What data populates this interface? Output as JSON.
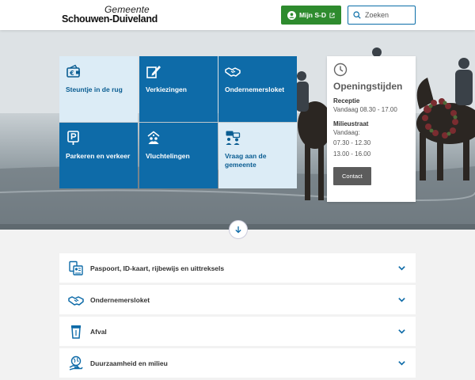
{
  "header": {
    "logo_line1": "Gemeente",
    "logo_line2": "Schouwen-Duiveland",
    "mijn_label": "Mijn S-D",
    "search_placeholder": "Zoeken"
  },
  "tiles": [
    {
      "label": "Steuntje in de rug",
      "icon": "euro-wallet-icon"
    },
    {
      "label": "Verkiezingen",
      "icon": "ballot-pen-icon"
    },
    {
      "label": "Ondernemersloket",
      "icon": "handshake-icon"
    },
    {
      "label": "Parkeren en verkeer",
      "icon": "parking-sign-icon"
    },
    {
      "label": "Vluchtelingen",
      "icon": "refugee-house-icon"
    },
    {
      "label": "Vraag aan de gemeente",
      "icon": "chat-people-icon"
    }
  ],
  "hours": {
    "title": "Openingstijden",
    "reception_title": "Receptie",
    "reception_today": "Vandaag 08.30 - 17.00",
    "milieu_title": "Milieustraat",
    "milieu_today_label": "Vandaag:",
    "milieu_slot1": "07.30 - 12.30",
    "milieu_slot2": "13.00 - 16.00",
    "contact_label": "Contact"
  },
  "accordion": [
    {
      "label": "Paspoort, ID-kaart, rijbewijs en uittreksels",
      "icon": "id-documents-icon"
    },
    {
      "label": "Ondernemersloket",
      "icon": "handshake-icon"
    },
    {
      "label": "Afval",
      "icon": "waste-bin-icon"
    },
    {
      "label": "Duurzaamheid en milieu",
      "icon": "globe-hand-icon"
    }
  ],
  "colors": {
    "primary_blue": "#0e6ba8",
    "light_tile": "#dcecf6",
    "green": "#2e8b2e"
  }
}
